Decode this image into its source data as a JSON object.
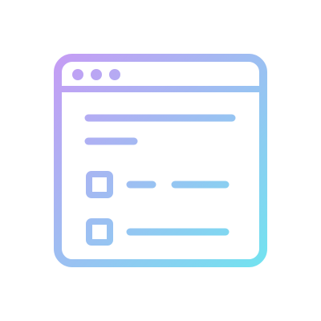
{
  "icon": {
    "name": "browser-window-checklist-icon",
    "gradient": {
      "start": "#c69cf4",
      "end": "#72e3f0"
    }
  }
}
